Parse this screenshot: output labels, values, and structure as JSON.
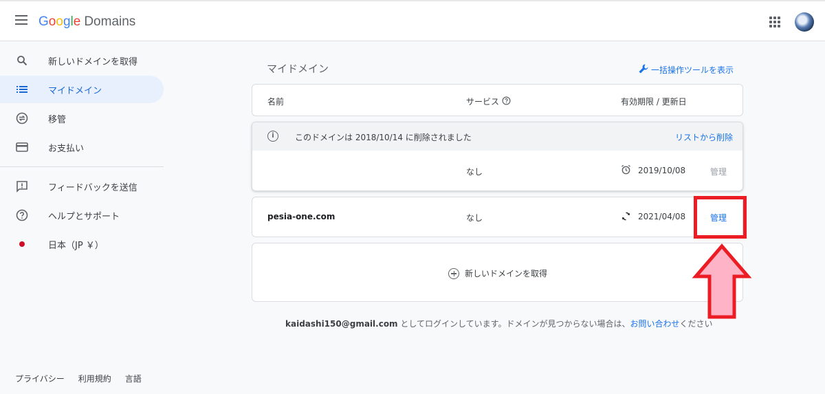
{
  "header": {
    "brand": "Google",
    "product": "Domains"
  },
  "sidebar": {
    "items": [
      {
        "label": "新しいドメインを取得",
        "icon": "search-icon"
      },
      {
        "label": "マイドメイン",
        "icon": "list-icon",
        "active": true
      },
      {
        "label": "移管",
        "icon": "transfer-icon"
      },
      {
        "label": "お支払い",
        "icon": "credit-card-icon"
      },
      {
        "label": "フィードバックを送信",
        "icon": "feedback-icon"
      },
      {
        "label": "ヘルプとサポート",
        "icon": "help-icon"
      },
      {
        "label": "日本（JP ￥）",
        "icon": "japan-flag-dot"
      }
    ],
    "footer": [
      "プライバシー",
      "利用規約",
      "言語"
    ]
  },
  "main": {
    "title": "マイドメイン",
    "bulk_link": "一括操作ツールを表示",
    "columns": {
      "name": "名前",
      "service": "サービス",
      "expiry": "有効期限 / 更新日"
    },
    "deleted": {
      "notice": "このドメインは 2018/10/14 に削除されました",
      "remove": "リストから削除",
      "service": "なし",
      "date": "2019/10/08",
      "manage": "管理"
    },
    "active": {
      "domain": "pesia-one.com",
      "service": "なし",
      "date": "2021/04/08",
      "manage": "管理"
    },
    "add_domain": "新しいドメインを取得",
    "login": {
      "email": "kaidashi150@gmail.com",
      "text": " としてログインしています。ドメインが見つからない場合は、",
      "contact": "お問い合わせ",
      "suffix": "ください"
    }
  },
  "colors": {
    "accent": "#1a73e8",
    "highlight": "#ec1c24",
    "arrow_fill": "#ffb3c6"
  }
}
